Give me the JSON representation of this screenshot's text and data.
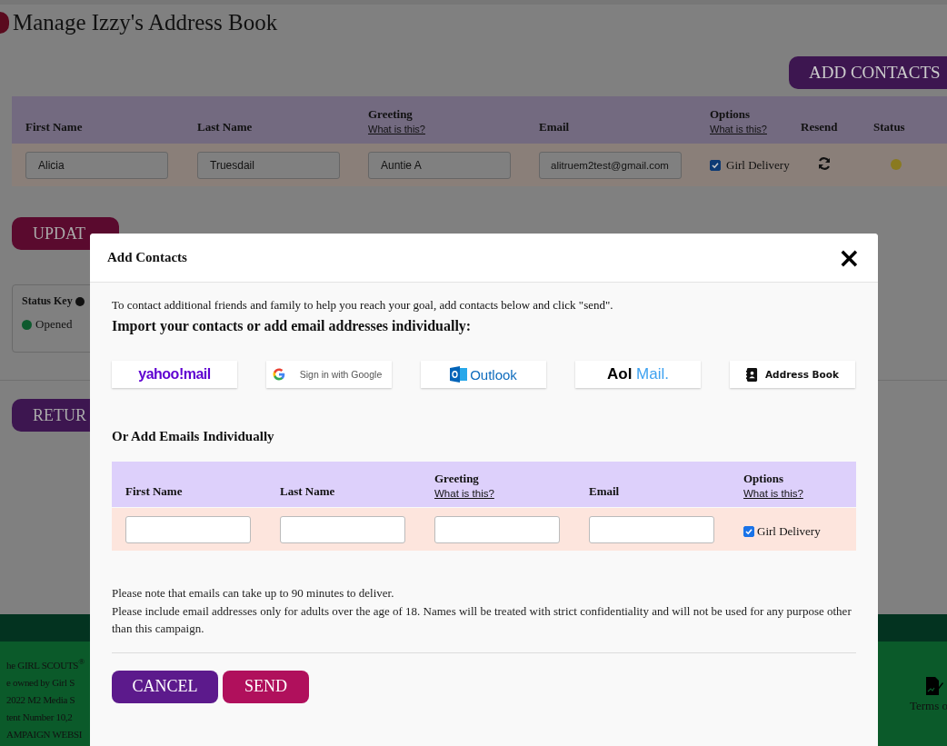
{
  "page": {
    "title": "Manage Izzy's Address Book",
    "add_button": "ADD CONTACTS",
    "table": {
      "columns": [
        {
          "label": "First Name"
        },
        {
          "label": "Last Name"
        },
        {
          "label": "Greeting",
          "link": "What is this?"
        },
        {
          "label": "Email"
        },
        {
          "label": "Options",
          "link": "What is this?"
        },
        {
          "label": "Resend"
        },
        {
          "label": "Status"
        }
      ],
      "rows": [
        {
          "first_name": "Alicia",
          "last_name": "Truesdail",
          "greeting": "Auntie A",
          "email": "alitruem2test@gmail.com",
          "option": {
            "label": "Girl Delivery",
            "checked": true
          },
          "color": "#8a7a20"
        }
      ]
    },
    "update_button": "UPDAT",
    "status_key": {
      "title": "Status Key",
      "items": [
        {
          "label": "Opened",
          "color": "#0d5a2e"
        }
      ]
    },
    "return_button": "RETUR",
    "footer": {
      "lines": [
        "he GIRL SCOUTS$^{®}$",
        "e owned by Girl S",
        "2022 M2 Media S",
        "tent Number 10,2",
        "AMPAIGN WEBSI"
      ],
      "terms": "Terms o"
    }
  },
  "modal": {
    "title": "Add Contacts",
    "close": "×",
    "intro": "To contact additional friends and family to help you reach your goal, add contacts below and click \"send\".",
    "import_heading": "Import your contacts or add email addresses individually:",
    "providers": [
      {
        "kind": "yahoo",
        "label": "yahoo!mail"
      },
      {
        "kind": "google",
        "label": "Sign in with Google"
      },
      {
        "kind": "outlook",
        "label": "Outlook"
      },
      {
        "kind": "aol",
        "label": "Aol",
        "label_2": "Mail."
      },
      {
        "kind": "addressbook",
        "label": "Address Book"
      }
    ],
    "individual_heading": "Or Add Emails Individually",
    "table": {
      "columns": [
        {
          "label": "First Name"
        },
        {
          "label": "Last Name"
        },
        {
          "label": "Greeting",
          "link": "What is this?"
        },
        {
          "label": "Email"
        },
        {
          "label": "Options",
          "link": "What is this?"
        }
      ],
      "row": {
        "option": {
          "label": "Girl Delivery",
          "checked": true
        }
      }
    },
    "notes": [
      "Please note that emails can take up to 90 minutes to deliver.",
      "Please include email addresses only for adults over the age of 18. Names will be treated with strict confidentiality and will not be used for any purpose other than this campaign."
    ],
    "buttons": [
      {
        "kind": "cancel",
        "label": "CANCEL"
      },
      {
        "kind": "send",
        "label": "SEND"
      }
    ]
  }
}
